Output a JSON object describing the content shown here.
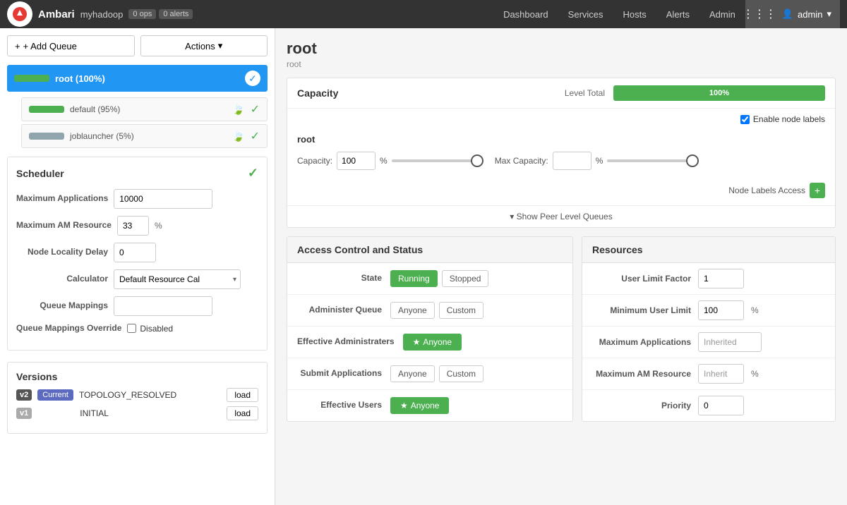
{
  "app": {
    "name": "Ambari",
    "cluster": "myhadoop",
    "ops_badge": "0 ops",
    "alerts_badge": "0 alerts"
  },
  "topnav": {
    "links": [
      "Dashboard",
      "Services",
      "Hosts",
      "Alerts",
      "Admin"
    ],
    "user": "admin"
  },
  "sidebar": {
    "add_queue_btn": "+ Add Queue",
    "actions_btn": "Actions",
    "queues": {
      "root": {
        "label": "root (100%)",
        "percent": 100,
        "children": [
          {
            "label": "default (95%)",
            "percent": 95
          },
          {
            "label": "joblauncher (5%)",
            "percent": 5,
            "small": true
          }
        ]
      }
    },
    "scheduler": {
      "title": "Scheduler",
      "fields": {
        "max_applications_label": "Maximum Applications",
        "max_applications_value": "10000",
        "max_am_resource_label": "Maximum AM Resource",
        "max_am_resource_value": "33",
        "max_am_resource_unit": "%",
        "node_locality_delay_label": "Node Locality Delay",
        "node_locality_delay_value": "0",
        "calculator_label": "Calculator",
        "calculator_value": "Default Resource Cal",
        "queue_mappings_label": "Queue Mappings",
        "queue_mappings_value": "",
        "queue_mappings_override_label": "Queue Mappings Override",
        "queue_mappings_override_value": "Disabled"
      }
    },
    "versions": {
      "title": "Versions",
      "items": [
        {
          "version": "v2",
          "is_current": true,
          "current_label": "Current",
          "name": "TOPOLOGY_RESOLVED",
          "load_btn": "load"
        },
        {
          "version": "v1",
          "is_current": false,
          "name": "INITIAL",
          "load_btn": "load"
        }
      ]
    }
  },
  "main": {
    "title": "root",
    "subtitle": "root",
    "capacity": {
      "section_title": "Capacity",
      "level_total_label": "Level Total",
      "level_total_percent": "100%",
      "queue_label": "root",
      "capacity_label": "Capacity:",
      "capacity_value": "100",
      "capacity_unit": "%",
      "max_capacity_label": "Max Capacity:",
      "max_capacity_value": "",
      "max_capacity_unit": "%",
      "enable_node_labels_text": "Enable node labels",
      "node_labels_access_label": "Node Labels Access",
      "show_peer_queues": "Show Peer Level Queues"
    },
    "access_control": {
      "title": "Access Control and Status",
      "state_label": "State",
      "state_running": "Running",
      "state_stopped": "Stopped",
      "administer_queue_label": "Administer Queue",
      "administer_anyone": "Anyone",
      "administer_custom": "Custom",
      "effective_admin_label": "Effective Administraters",
      "effective_admin_value": "Anyone",
      "submit_apps_label": "Submit Applications",
      "submit_anyone": "Anyone",
      "submit_custom": "Custom",
      "effective_users_label": "Effective Users",
      "effective_users_value": "Anyone"
    },
    "resources": {
      "title": "Resources",
      "user_limit_factor_label": "User Limit Factor",
      "user_limit_factor_value": "1",
      "min_user_limit_label": "Minimum User Limit",
      "min_user_limit_value": "100",
      "min_user_limit_unit": "%",
      "max_applications_label": "Maximum Applications",
      "max_applications_value": "Inherited",
      "max_am_resource_label": "Maximum AM Resource",
      "max_am_resource_value": "Inherit",
      "max_am_resource_unit": "%",
      "priority_label": "Priority",
      "priority_value": "0"
    }
  }
}
